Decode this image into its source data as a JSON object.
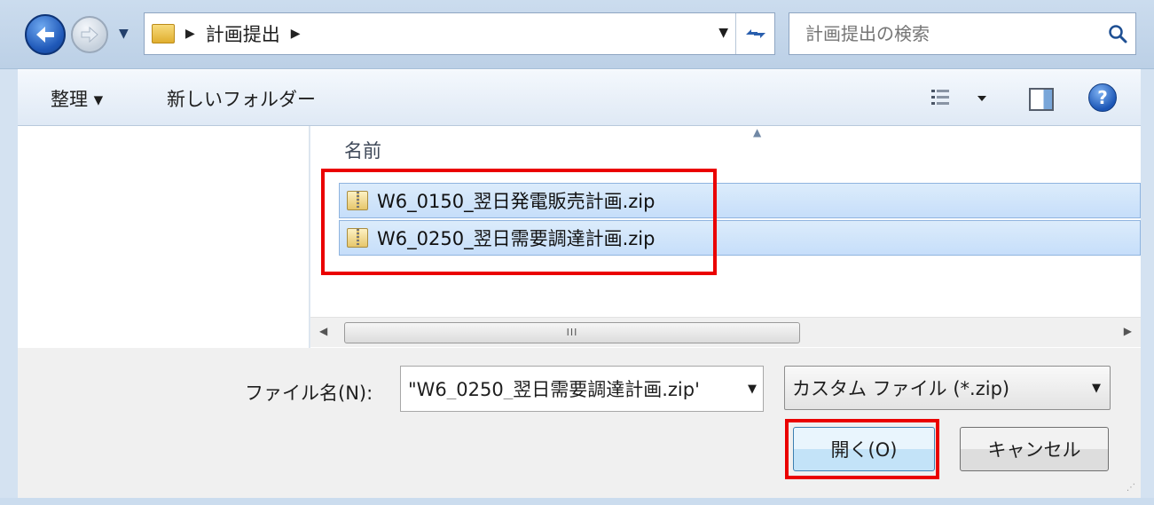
{
  "address_bar": {
    "breadcrumb": [
      "計画提出"
    ],
    "search_placeholder": "計画提出の検索"
  },
  "command_bar": {
    "organize_label": "整理 ▾",
    "new_folder_label": "新しいフォルダー"
  },
  "file_list": {
    "column_name": "名前",
    "files": [
      {
        "name": "W6_0150_翌日発電販売計画.zip",
        "selected": true
      },
      {
        "name": "W6_0250_翌日需要調達計画.zip",
        "selected": true
      }
    ],
    "scrollbar_grip": "III"
  },
  "bottom": {
    "filename_label": "ファイル名(N):",
    "filename_value": "\"W6_0250_翌日需要調達計画.zip'",
    "filter_value": "カスタム ファイル (*.zip)",
    "open_label": "開く(O)",
    "cancel_label": "キャンセル"
  },
  "colors": {
    "highlight": "#ea0000",
    "selection": "#c6defa",
    "chrome": "#cbdcee"
  }
}
